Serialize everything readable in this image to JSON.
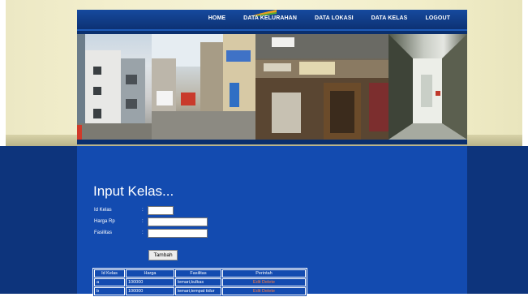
{
  "nav": {
    "items": [
      "HOME",
      "DATA KELURAHAN",
      "DATA LOKASI",
      "DATA KELAS",
      "LOGOUT"
    ]
  },
  "page": {
    "title": "Input Kelas..."
  },
  "form": {
    "fields": [
      {
        "label": "Id Kelas",
        "colon": ":",
        "value": ""
      },
      {
        "label": "Harga Rp",
        "colon": ":",
        "value": ""
      },
      {
        "label": "Fasilitas",
        "colon": ":",
        "value": ""
      }
    ],
    "submit_label": "Tambah"
  },
  "table": {
    "headers": [
      "Id Kelas",
      "Harga",
      "Fasilitas",
      "Perintah"
    ],
    "rows": [
      {
        "id": "a",
        "harga": "100000",
        "fasilitas": "lemari,kulkas",
        "edit": "Edit",
        "delete": "Delete"
      },
      {
        "id": "b",
        "harga": "100000",
        "fasilitas": "lemari,tempat tidur",
        "edit": "Edit",
        "delete": "Delete"
      }
    ]
  },
  "colors": {
    "accent": "#ff7a3d",
    "content_bg": "#134bb0",
    "header_bg": "#0a2f6e"
  }
}
